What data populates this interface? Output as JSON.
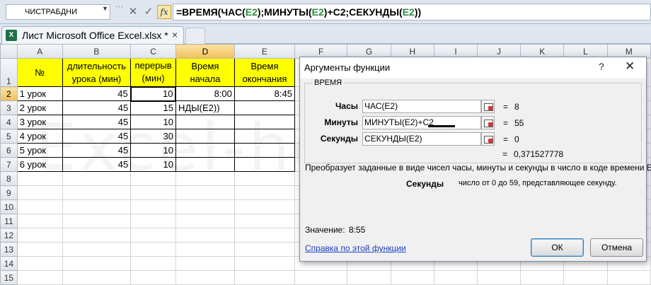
{
  "formula_bar": {
    "name_box": "ЧИСТРАБДНИ",
    "cancel_glyph": "✕",
    "enter_glyph": "✓",
    "fx_glyph": "fx",
    "formula_parts": [
      "=ВРЕМЯ(ЧАС(",
      "E2",
      ");МИНУТЫ(",
      "E2",
      ")+C2;СЕКУНДЫ(",
      "E2",
      "))"
    ]
  },
  "workbook": {
    "tab_title": "Лист Microsoft Office Excel.xlsx *",
    "tab_close": "×",
    "icon_letter": "X"
  },
  "sheet": {
    "columns": [
      "A",
      "B",
      "C",
      "D",
      "E",
      "F",
      "G",
      "H",
      "I",
      "J",
      "K",
      "L",
      "M"
    ],
    "rows": [
      "1",
      "2",
      "3",
      "4",
      "5",
      "6",
      "7",
      "8",
      "9",
      "10",
      "11",
      "12",
      "13",
      "14",
      "15"
    ],
    "headers": [
      "№",
      "длительность урока (мин)",
      "перерыв (мин)",
      "Время начала",
      "Время окончания"
    ],
    "data": [
      [
        "1 урок",
        "45",
        "10",
        "8:00",
        "8:45"
      ],
      [
        "2 урок",
        "45",
        "15",
        "НДЫ(E2))",
        ""
      ],
      [
        "3 урок",
        "45",
        "10",
        "",
        ""
      ],
      [
        "4 урок",
        "45",
        "30",
        "",
        ""
      ],
      [
        "5 урок",
        "45",
        "10",
        "",
        ""
      ],
      [
        "6 урок",
        "45",
        "10",
        "",
        ""
      ]
    ]
  },
  "watermark": "Excel-helper.ru",
  "dialog": {
    "title": "Аргументы функции",
    "help": "?",
    "close": "✕",
    "function_name": "ВРЕМЯ",
    "args": [
      {
        "label": "Часы",
        "value": "ЧАС(E2)",
        "result": "8"
      },
      {
        "label": "Минуты",
        "value": "МИНУТЫ(E2)+C2",
        "result": "55"
      },
      {
        "label": "Секунды",
        "value": "СЕКУНДЫ(E2)",
        "result": "0"
      }
    ],
    "eq": "=",
    "result": "0,371527778",
    "description": "Преобразует заданные в виде чисел часы, минуты и секунды в число в коде времени Excel.",
    "param_name": "Секунды",
    "param_desc": "число от 0 до 59, представляющее секунду.",
    "value_label": "Значение:",
    "value": "8:55",
    "help_link": "Справка по этой функции",
    "ok": "ОК",
    "cancel": "Отмена"
  }
}
